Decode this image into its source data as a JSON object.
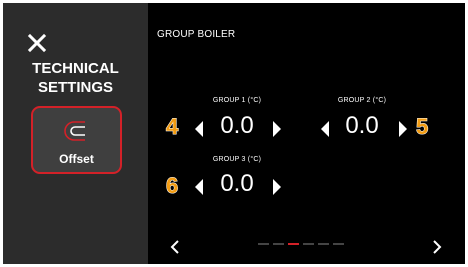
{
  "colors": {
    "accent": "#d32128",
    "badge": "#f39c12",
    "screen_bg": "#000000",
    "sidebar_bg": "#2c2c2c",
    "button_bg": "#3f3f3f",
    "indicator_inactive": "#444444"
  },
  "sidebar": {
    "close_icon": "close-icon",
    "title_line1": "TECHNICAL",
    "title_line2": "SETTINGS",
    "offset_button": {
      "label": "Offset",
      "icon": "offset-icon",
      "selected": true
    }
  },
  "main": {
    "title": "GROUP BOILER",
    "groups": [
      {
        "label": "GROUP 1 (°C)",
        "value": "0.0",
        "badge": "4"
      },
      {
        "label": "GROUP 2 (°C)",
        "value": "0.0",
        "badge": "5"
      },
      {
        "label": "GROUP 3 (°C)",
        "value": "0.0",
        "badge": "6"
      }
    ],
    "nav": {
      "prev_icon": "chevron-left-icon",
      "next_icon": "chevron-right-icon"
    },
    "pager": {
      "total": 6,
      "current": 3
    }
  }
}
